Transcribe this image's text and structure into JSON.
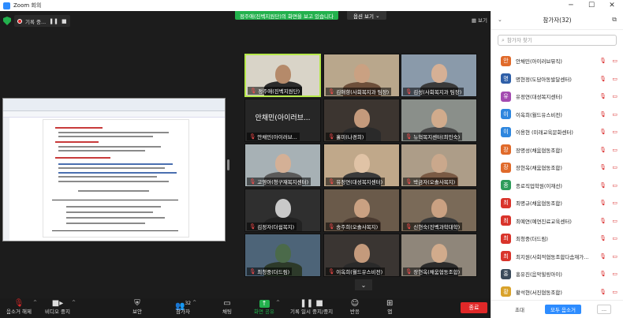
{
  "window": {
    "title": "Zoom 회의"
  },
  "top": {
    "recording_label": "기록 중...",
    "share_banner": "정주애(진벡지원단)의 화면을 보고 있습니다",
    "share_menu": "옵션 보기",
    "view_label": "보기",
    "colors": {
      "security": "#23b14d",
      "banner": "#23b14d",
      "record": "#e02828"
    }
  },
  "tiles": [
    {
      "name": "정주애(진벡지원단)",
      "active": true,
      "bg": "#d9d4c8",
      "face": "#b58a6a",
      "body": "#2b2b2b",
      "hair": "#1a1a1a"
    },
    {
      "name": "김애향(사회복지과 팀장)",
      "bg": "#b9a78c",
      "face": "#caa182",
      "body": "#6d4f3a"
    },
    {
      "name": "김성(사회복지과 팀장)",
      "bg": "#8a9aaa",
      "face": "#d6b095",
      "body": "#3a3a3a"
    },
    {
      "name": "안채민(아이러브...",
      "textonly": true,
      "big": "안채민(아이러브..."
    },
    {
      "name": "홀미(나경희)",
      "bg": "#3c3530",
      "face": "#c49a7c",
      "body": "#2a2a2a"
    },
    {
      "name": "뉴혁목지센터(최인숙)",
      "bg": "#8a8f8a",
      "face": "#d1ab8c",
      "body": "#4a4a4a"
    },
    {
      "name": "고영아(청구재복지센터)",
      "bg": "#a7b1b5",
      "face": "#d4b096",
      "body": "#5a5a5a"
    },
    {
      "name": "유정연(대성복지센터)",
      "bg": "#c0a88a",
      "face": "#e0c3a6",
      "body": "#3a3a3a"
    },
    {
      "name": "박금자(오솔사목지)",
      "bg": "#ad9d88",
      "face": "#caa88c",
      "body": "#7a5a44"
    },
    {
      "name": "김정자(더쉼복지)",
      "bg": "#2f2f2f",
      "face": "#c9c9c9",
      "body": "#222"
    },
    {
      "name": "송주희(오솔사목지)",
      "bg": "#6a5a4a",
      "face": "#caa182",
      "body": "#4a3a30"
    },
    {
      "name": "신현숙(진벡과학대학)",
      "bg": "#7a6a58",
      "face": "#caa182",
      "body": "#3a3a3a"
    },
    {
      "name": "최청중(더드림)",
      "bg": "#4d6478",
      "face": "#4b6a4a",
      "body": "#2d3a2a"
    },
    {
      "name": "이옥희(월드유스비전)",
      "bg": "#3a3532",
      "face": "#c49a7c",
      "body": "#2a2a2a"
    },
    {
      "name": "장현옥(채움협동조합)",
      "bg": "#8f867a",
      "face": "#d1ab8c",
      "body": "#2c2c2c"
    }
  ],
  "toolbar": {
    "mute_label": "음소거 해제",
    "video_label": "비디오 중지",
    "security_label": "보안",
    "participants_label": "참가자",
    "participants_count": "32",
    "chat_label": "채팅",
    "share_label": "화면 공유",
    "pause_label": "기록 일시 중지/중지",
    "reaction_label": "반응",
    "apps_label": "앱",
    "end_label": "종료",
    "end_color": "#e02828"
  },
  "panel": {
    "title": "참가자(32)",
    "search_placeholder": "참가자 찾기",
    "participants": [
      {
        "initial": "안",
        "name": "안채민(아이러브뮤직)",
        "color": "#e06a2a"
      },
      {
        "initial": "명",
        "name": "명현정(도담아동발달센터)",
        "color": "#2f5fa8"
      },
      {
        "initial": "유",
        "name": "유정연(대성복지센터)",
        "color": "#a34ab0"
      },
      {
        "initial": "이",
        "name": "이옥희(월드유스비전)",
        "color": "#2e86de"
      },
      {
        "initial": "이",
        "name": "이용현 (미래교육문화센터)",
        "color": "#2e86de"
      },
      {
        "initial": "장",
        "name": "장명성(채움협동조합)",
        "color": "#e06a2a"
      },
      {
        "initial": "장",
        "name": "장현옥(채움협동조합)",
        "color": "#e06a2a"
      },
      {
        "initial": "종",
        "name": "종로직업학원(이재선)",
        "color": "#2e9c5a"
      },
      {
        "initial": "최",
        "name": "최명규(채움협동조합)",
        "color": "#d9342b"
      },
      {
        "initial": "최",
        "name": "최예연(예연진료교육센터)",
        "color": "#d9342b"
      },
      {
        "initial": "최",
        "name": "최청중(더드림)",
        "color": "#d9342b"
      },
      {
        "initial": "최",
        "name": "최지원(사회적협동조합다솜재가...",
        "color": "#d9342b"
      },
      {
        "initial": "홍",
        "name": "홍유진(음악힐링아이)",
        "color": "#3a4a5a"
      },
      {
        "initial": "황",
        "name": "황석현(서진협동조합)",
        "color": "#d9a22b"
      }
    ],
    "invite_label": "초대",
    "mute_all_label": "모두 음소거",
    "more_label": "..."
  }
}
